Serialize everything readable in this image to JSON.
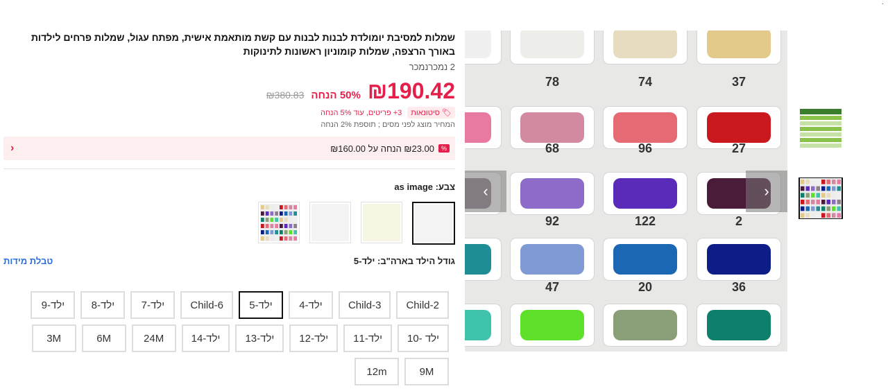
{
  "product": {
    "title": "שמלות למסיבת יומולדת לבנות לבנות עם קשת מותאמת אישית, מפתח עגול, שמלות פרחים לילדות באורך הרצפה, שמלות קומוניון ראשונות לתינוקות",
    "sold": "2 נמכרנמכר",
    "price": "₪190.42",
    "discount": "50% הנחה",
    "old_price": "₪380.83",
    "wholesale_badge": "סיטונאות",
    "wholesale_text": "3+ פריטים, עוד 5% הנחה",
    "tax_note": "המחיר מוצג לפני מסים ; תוספת 2% הנחה",
    "coupon_text": "₪23.00 הנחה על ₪160.00",
    "coupon_icon": "%",
    "color_label": "צבע: as image",
    "size_label": "גודל הילד בארה\"ב: ילד-5",
    "size_table_link": "טבלת מידות",
    "sizes": [
      "Child-2",
      "Child-3",
      "ילד-4",
      "ילד-5",
      "Child-6",
      "ילד-7",
      "ילד-8",
      "ילד-9",
      "ילד -10",
      "ילד-11",
      "ילד-12",
      "ילד-13",
      "ילד-14",
      "24M",
      "6M",
      "3M",
      "9M",
      "12m"
    ],
    "selected_size": "ילד-5"
  },
  "swatches": [
    {
      "color": "#f3f3f3",
      "selected": true
    },
    {
      "color": "#f7f5e3",
      "selected": false
    },
    {
      "color": "#f4f4f4",
      "selected": false
    },
    {
      "color": "chart",
      "selected": false
    }
  ],
  "gallery": {
    "numbers": [
      "37",
      "74",
      "78",
      "27",
      "96",
      "68",
      "2",
      "122",
      "92",
      "36",
      "20",
      "47"
    ],
    "fabric_colors": [
      [
        "#e3c98a",
        "#e7dcc0",
        "#ededea",
        "#f0f0f0"
      ],
      [
        "#c9191e",
        "#e56a73",
        "#d38aa0",
        "#e879a3"
      ],
      [
        "#4b1c3a",
        "#5a2bb8",
        "#8c6cc8",
        "#8e7e8e"
      ],
      [
        "#0d1d88",
        "#1c67b3",
        "#7f9ad4",
        "#1f8e94"
      ],
      [
        "#0e7f6a",
        "#8a9e78",
        "#5fe02b",
        "#3fc3ad"
      ]
    ],
    "prev_icon": "chevron-left",
    "next_icon": "chevron-right"
  }
}
